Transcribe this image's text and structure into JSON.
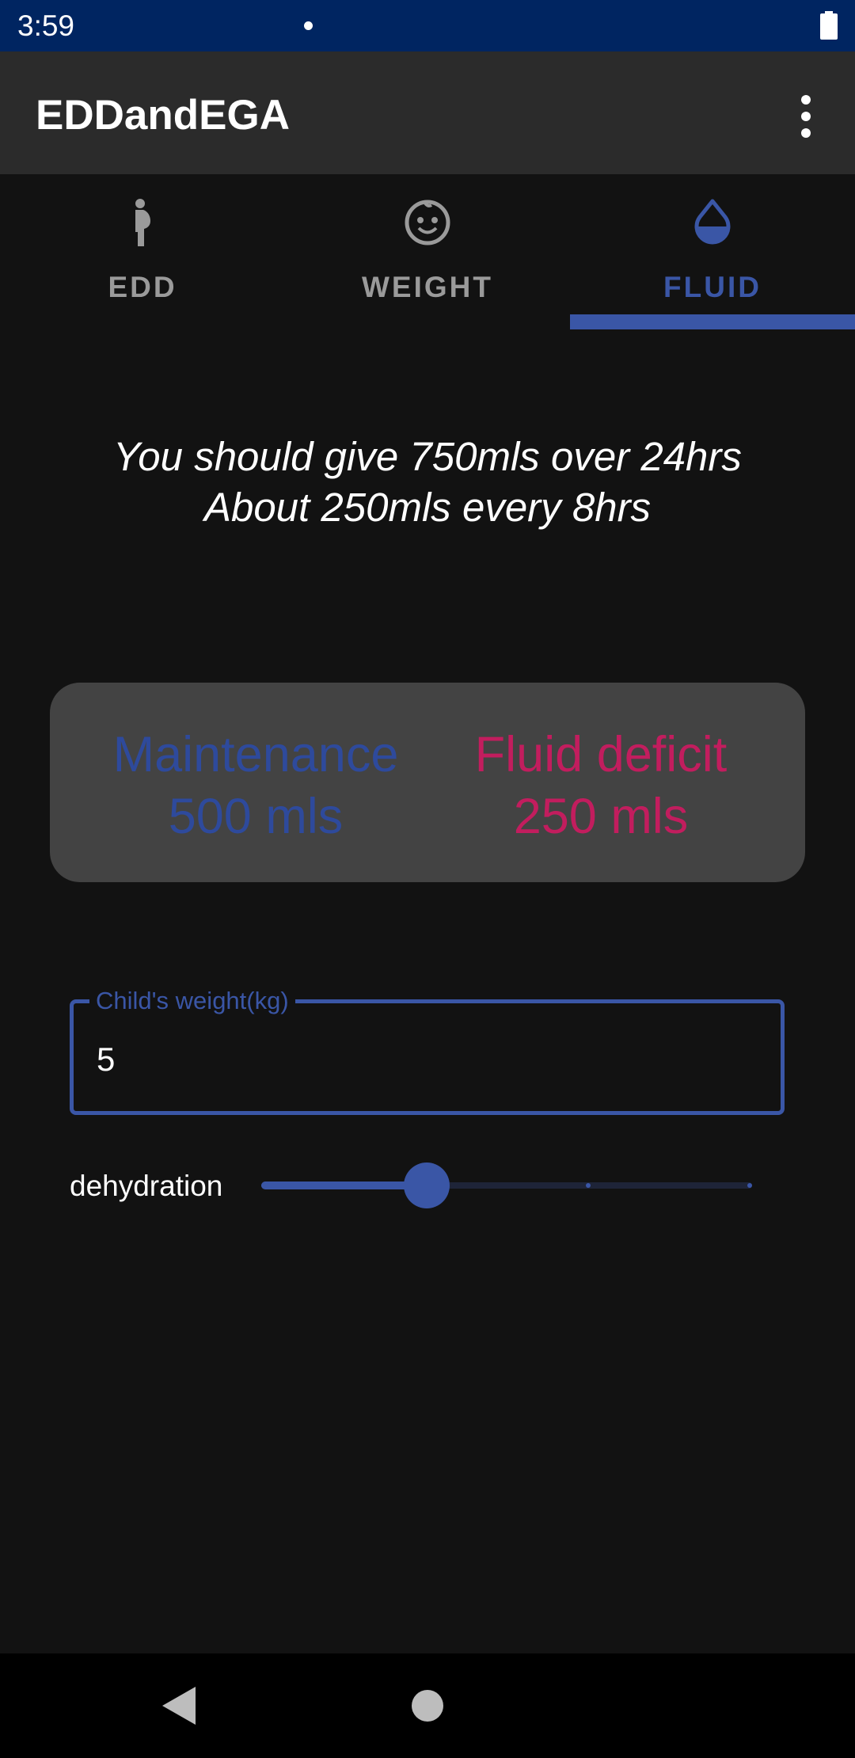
{
  "status_bar": {
    "time": "3:59"
  },
  "app_bar": {
    "title": "EDDandEGA",
    "menu_icon": "more-vert-icon"
  },
  "tabs": [
    {
      "label": "EDD",
      "icon": "pregnant-woman-icon",
      "active": false
    },
    {
      "label": "WEIGHT",
      "icon": "child-face-icon",
      "active": false
    },
    {
      "label": "FLUID",
      "icon": "water-drop-icon",
      "active": true
    }
  ],
  "result": {
    "line1": "You should give 750mls over 24hrs",
    "line2": "About 250mls every 8hrs"
  },
  "summary": {
    "maintenance_label": "Maintenance",
    "maintenance_value": "500 mls",
    "deficit_label": "Fluid deficit",
    "deficit_value": "250 mls"
  },
  "weight_field": {
    "label": "Child's weight(kg)",
    "value": "5"
  },
  "dehydration_slider": {
    "label": "dehydration",
    "steps": 4,
    "selected_index": 1,
    "fraction": 0.333
  },
  "colors": {
    "accent": "#3a56a6",
    "maintenance": "#2e4a9c",
    "deficit": "#c21d5e",
    "status_bar": "#002561",
    "app_bar": "#2b2b2b",
    "background": "#121212"
  }
}
